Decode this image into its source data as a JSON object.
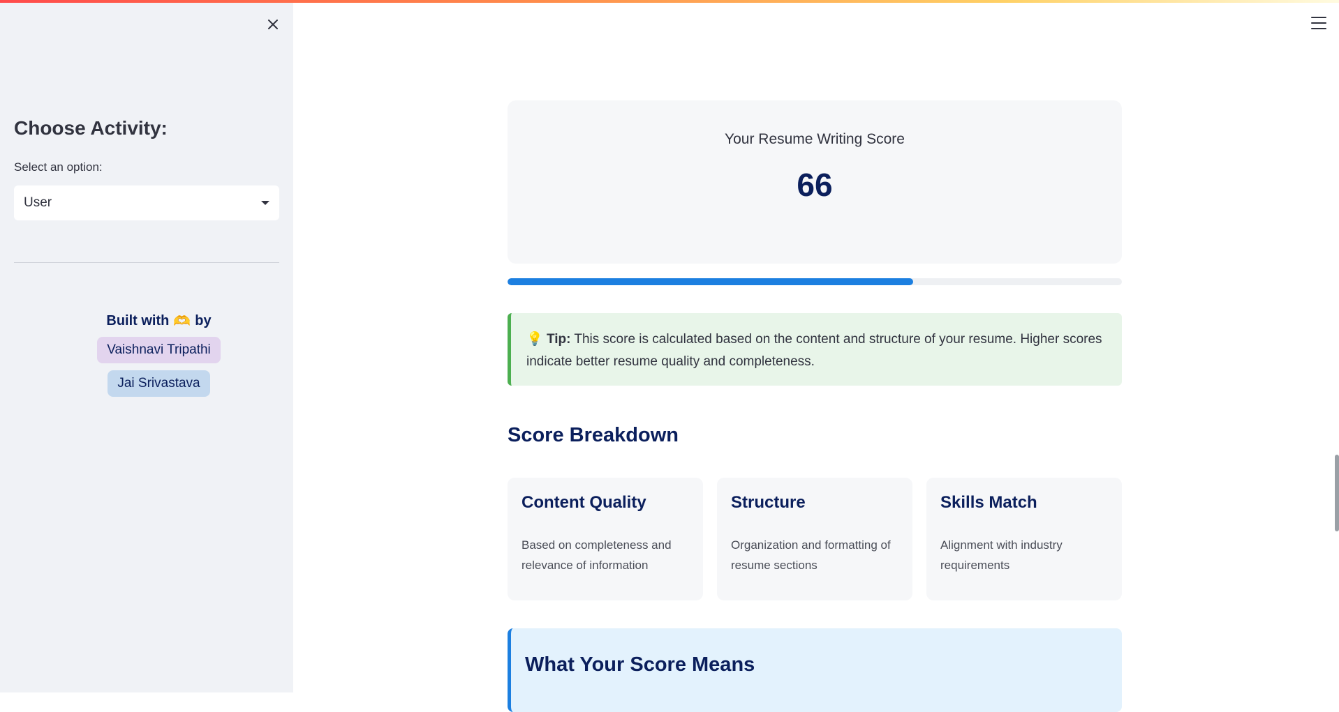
{
  "sidebar": {
    "close_icon": "close-icon",
    "heading": "Choose Activity:",
    "select_label": "Select an option:",
    "select_value": "User",
    "built_with_prefix": "Built with",
    "built_with_emoji": "🫶",
    "built_with_suffix": "by",
    "authors": [
      "Vaishnavi Tripathi",
      "Jai Srivastava"
    ]
  },
  "header": {
    "menu_icon": "hamburger-menu-icon"
  },
  "score": {
    "label": "Your Resume Writing Score",
    "value": "66",
    "progress_percent": 66
  },
  "tip": {
    "icon": "💡",
    "strong": "Tip:",
    "text": "This score is calculated based on the content and structure of your resume. Higher scores indicate better resume quality and completeness."
  },
  "breakdown": {
    "heading": "Score Breakdown",
    "cards": [
      {
        "title": "Content Quality",
        "description": "Based on completeness and relevance of information"
      },
      {
        "title": "Structure",
        "description": "Organization and formatting of resume sections"
      },
      {
        "title": "Skills Match",
        "description": "Alignment with industry requirements"
      }
    ]
  },
  "meaning": {
    "heading": "What Your Score Means"
  },
  "colors": {
    "accent": "#1c7fe0",
    "heading": "#0b1f5c",
    "tip_border": "#4caf50",
    "tip_bg": "#e8f5e9"
  }
}
